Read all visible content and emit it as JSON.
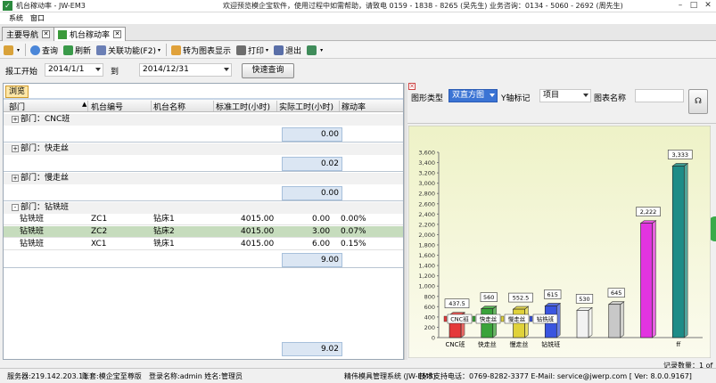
{
  "window": {
    "title": "机台稼动率 - JW-EM3",
    "welcome": "欢迎预览模企宝软件，使用过程中如需帮助，请致电 0159 - 1838 - 8265 (吴先生)    业务咨询：0134 - 5060 - 2692 (周先生)"
  },
  "menu": {
    "items": [
      "系统",
      "窗口"
    ]
  },
  "tabs": [
    {
      "label": "主要导航"
    },
    {
      "label": "机台稼动率"
    }
  ],
  "toolbar": {
    "query": "查询",
    "refresh": "刷新",
    "related": "关联功能(F2)",
    "to_chart": "转为图表显示",
    "print": "打印",
    "exit": "退出"
  },
  "filter": {
    "start_label": "报工开始",
    "start_value": "2014/1/1",
    "to_label": "到",
    "end_value": "2014/12/31",
    "query_button": "快速查询"
  },
  "grid": {
    "tab": "浏览",
    "columns": [
      "部门",
      "机台编号",
      "机台名称",
      "标准工时(小时)",
      "实际工时(小时)",
      "稼动率"
    ],
    "groups": [
      {
        "label": "部门：CNC班",
        "toggle": "+",
        "sum": "0.00"
      },
      {
        "label": "部门：快走丝",
        "toggle": "+",
        "sum": "0.02"
      },
      {
        "label": "部门：慢走丝",
        "toggle": "+",
        "sum": "0.00"
      },
      {
        "label": "部门：钻铣班",
        "toggle": "-",
        "sum": "9.00"
      }
    ],
    "rows": [
      {
        "dept": "钻铣班",
        "code": "ZC1",
        "name": "钻床1",
        "std": "4015.00",
        "actual": "0.00",
        "rate": "0.00%"
      },
      {
        "dept": "钻铣班",
        "code": "ZC2",
        "name": "钻床2",
        "std": "4015.00",
        "actual": "3.00",
        "rate": "0.07%"
      },
      {
        "dept": "钻铣班",
        "code": "XC1",
        "name": "铣床1",
        "std": "4015.00",
        "actual": "6.00",
        "rate": "0.15%"
      }
    ],
    "total": "9.02",
    "record_count": "记录数量：1 of 7"
  },
  "chart_panel": {
    "type_label": "图形类型",
    "type_value": "双直方图",
    "y_label": "Y轴标记",
    "y_value": "项目",
    "name_label": "图表名称",
    "name_value": ""
  },
  "chart_data": {
    "type": "bar",
    "ylim": [
      0,
      3600
    ],
    "yticks": [
      "0",
      "200",
      "400",
      "600",
      "800",
      "1,000",
      "1,200",
      "1,400",
      "1,600",
      "1,800",
      "2,000",
      "2,200",
      "2,400",
      "2,600",
      "2,800",
      "3,000",
      "3,200",
      "3,400",
      "3,600"
    ],
    "legend": [
      "CNC班",
      "快走丝",
      "慢走丝",
      "钻铣班"
    ],
    "bars": [
      {
        "value": 437.5,
        "label": "437.5",
        "color": "#e53a3a",
        "label_shown": true
      },
      {
        "value": 560,
        "label": "560",
        "color": "#3aa33a",
        "label_shown": true
      },
      {
        "value": 552.5,
        "label": "552.5",
        "color": "#e0d23a",
        "label_shown": true
      },
      {
        "value": 615,
        "label": "615",
        "color": "#3a55e0",
        "label_shown": true
      },
      {
        "value": 530,
        "label": "530",
        "color": "#f2f2f2",
        "label_shown": true
      },
      {
        "value": 645,
        "label": "645",
        "color": "#c8c8c8",
        "label_shown": true
      },
      {
        "value": 2222,
        "label": "2,222",
        "color": "#e234e0",
        "label_shown": true
      },
      {
        "value": 3333,
        "label": "3,333",
        "color": "#1e8c87",
        "label_shown": true
      }
    ],
    "categories": [
      "CNC班",
      "快走丝",
      "慢走丝",
      "钻铣班",
      "",
      "",
      "",
      "ff"
    ]
  },
  "status": {
    "server": "服务器:219.142.203.11",
    "account": "账套:模企宝至尊版",
    "login": "登录名称:admin  姓名:管理员",
    "system": "精伟模具管理系统 (JW-EM3)",
    "support": "技术支持电话：0769-8282-3377  E-Mail: service@jwerp.com   [ Ver: 8.0.0.9167]"
  }
}
